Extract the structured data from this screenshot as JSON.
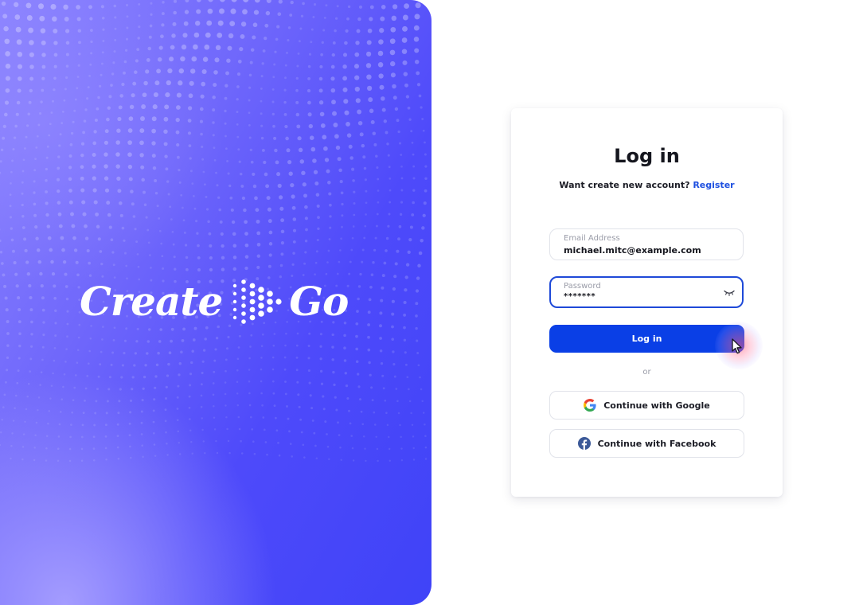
{
  "hero": {
    "logo_left": "Create",
    "logo_right": "Go"
  },
  "login": {
    "title": "Log in",
    "register_prompt": "Want create new account?",
    "register_link": "Register",
    "email_label": "Email Address",
    "email_value": "michael.mitc@example.com",
    "password_label": "Password",
    "password_value": "*******",
    "login_button": "Log in",
    "divider": "or",
    "google_button": "Continue with Google",
    "facebook_button": "Continue with Facebook"
  },
  "icons": {
    "password_toggle": "eye-closed-icon",
    "google": "google-icon",
    "facebook": "facebook-icon",
    "cursor": "mouse-pointer-icon",
    "brand": "dot-arrow-logo-icon"
  },
  "colors": {
    "primary": "#0a3fe6",
    "link": "#1d4fe0",
    "hero_dark": "#3f43f8",
    "hero_light": "#a8a0ff",
    "facebook": "#3b5998"
  }
}
